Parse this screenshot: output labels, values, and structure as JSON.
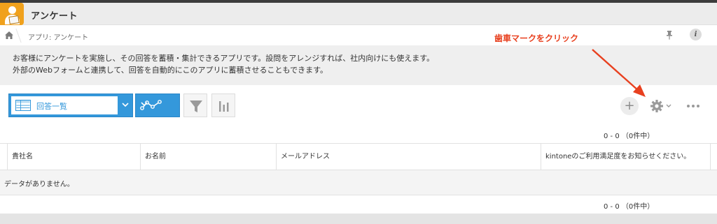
{
  "app": {
    "title": "アンケート"
  },
  "breadcrumb": {
    "text": "アプリ: アンケート"
  },
  "annotation": {
    "text": "歯車マークをクリック",
    "color": "#e8401f"
  },
  "description": {
    "line1": "お客様にアンケートを実施し、その回答を蓄積・集計できるアプリです。設問をアレンジすれば、社内向けにも使えます。",
    "line2": "外部のWebフォームと連携して、回答を自動的にこのアプリに蓄積させることもできます。"
  },
  "toolbar": {
    "view_label": "回答一覧",
    "add_label": "+"
  },
  "pagination": {
    "top": "0 - 0 （0件中）",
    "bottom": "0 - 0 （0件中）"
  },
  "table": {
    "columns": [
      "貴社名",
      "お名前",
      "メールアドレス",
      "kintoneのご利用満足度をお知らせください。"
    ],
    "empty_message": "データがありません。"
  },
  "colors": {
    "accent": "#3498db",
    "app_icon": "#f0a11c"
  },
  "icons": [
    "home-icon",
    "pin-icon",
    "info-icon",
    "list-view-icon",
    "chevron-down-icon",
    "graph-icon",
    "filter-icon",
    "bar-chart-icon",
    "plus-icon",
    "gear-icon",
    "more-icon"
  ]
}
